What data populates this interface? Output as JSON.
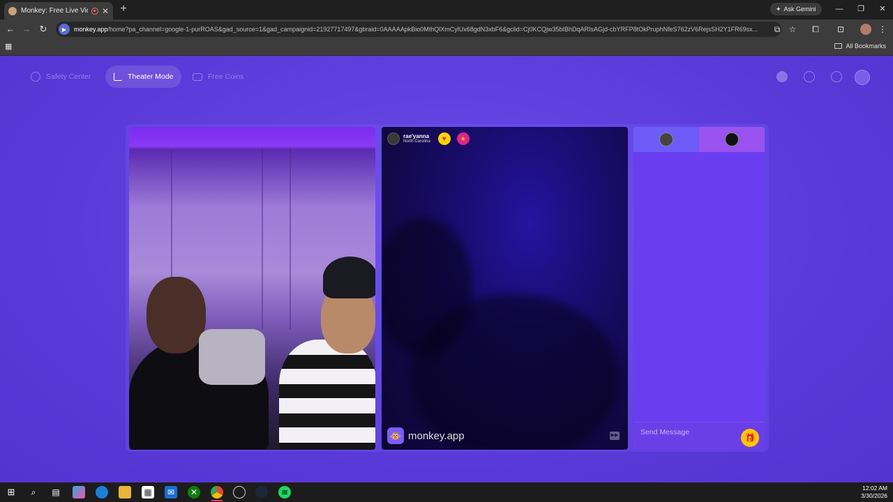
{
  "browser": {
    "tab_title": "Monkey: Free Live Video Ch",
    "tab_close": "✕",
    "new_tab": "+",
    "ask_gemini": "Ask Gemini",
    "url_host": "monkey.app",
    "url_path": "/home?pa_channel=google-1-purROAS&gad_source=1&gad_campaignid=21927717497&gbraid=0AAAAApkBio0MthQlXmCylUx68gdN3xbF6&gclid=Cj0KCQjw35bIBhDqARIsAGjd-cbYRFP8tOkPruphNfeS762zV6RejsSH2Y1FR69sx...",
    "all_bookmarks": "All Bookmarks"
  },
  "topnav": {
    "safety_center": "Safety Center",
    "theater_mode": "Theater Mode",
    "free_coins": "Free Coins"
  },
  "remote": {
    "name": "rae'yanna",
    "location": "North Carolina",
    "brand": "monkey.app"
  },
  "chat": {
    "placeholder": "Send Message"
  },
  "taskbar": {
    "time": "12:02 AM",
    "date": "3/30/2026"
  },
  "colors": {
    "page_bg": "#5a3ad8",
    "chat_bg": "#6a3ef0",
    "gift": "#ffc400"
  }
}
